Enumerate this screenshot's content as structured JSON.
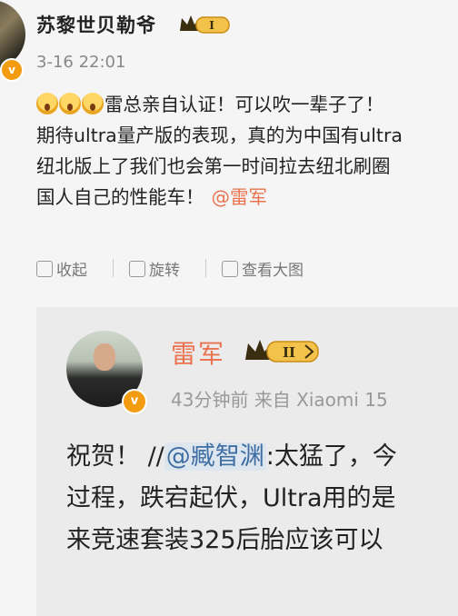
{
  "post": {
    "author": "苏黎世贝勒爷",
    "badge_text": "I",
    "verify_mark": "v",
    "time": "3-16 22:01",
    "lines": [
      "雷总亲自认证！可以吹一辈子了！",
      "期待ultra量产版的表现，真的为中国有ultra",
      "纽北版上了我们也会第一时间拉去纽北刷圈",
      "国人自己的性能车！"
    ],
    "mention": "@雷军",
    "emojis": [
      "scream-emoji",
      "scream-emoji",
      "scream-emoji"
    ],
    "actions": {
      "collapse": "收起",
      "repost": "旋转",
      "view_large": "查看大图"
    }
  },
  "repost": {
    "author": "雷军",
    "badge_text": "II",
    "verify_mark": "v",
    "meta": "43分钟前  来自 Xiaomi 15",
    "line1_prefix": "祝贺！ //",
    "line1_mention": "@臧智渊",
    "line1_suffix": ":太猛了，今",
    "line2": "过程，跌宕起伏，Ultra用的是",
    "line3": "来竞速套装325后胎应该可以"
  },
  "colors": {
    "accent_orange": "#eb7350",
    "verify_badge": "#f39c12",
    "crown_gold": "#e6a23c"
  }
}
